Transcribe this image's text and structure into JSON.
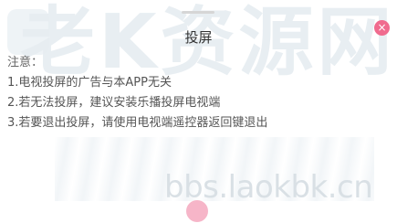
{
  "watermark": {
    "big_text": "老K资源网",
    "small_text": "bbs.laokbk.cn"
  },
  "dialog": {
    "title": "投屏",
    "close_glyph": "×",
    "notice_heading": "注意：",
    "notices": [
      "1.电视投屏的广告与本APP无关",
      "2.若无法投屏，建议安装乐播投屏电视端",
      "3.若要退出投屏，请使用电视端遥控器返回键退出"
    ]
  },
  "colors": {
    "accent": "#f06b8e",
    "text": "#555555",
    "title": "#333333"
  },
  "icons": {
    "close": "close-icon"
  }
}
